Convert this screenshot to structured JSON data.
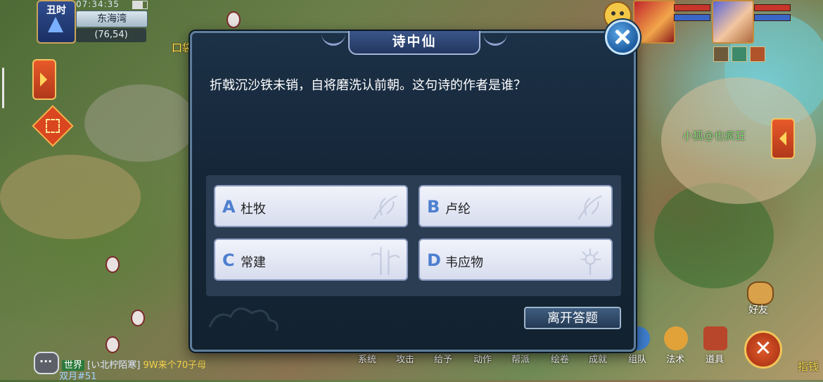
{
  "hud": {
    "time_badge": "丑时",
    "clock": "07:34:35",
    "map_name": "东海湾",
    "coords": "(76,54)",
    "bag_label": "口袋"
  },
  "scene": {
    "player_name": "小狐@也疯狂",
    "edge_text": "指钱"
  },
  "quiz": {
    "title": "诗中仙",
    "question": "折戟沉沙铁未销，自将磨洗认前朝。这句诗的作者是谁？",
    "answers": [
      {
        "letter": "A",
        "text": "杜牧"
      },
      {
        "letter": "B",
        "text": "卢纶"
      },
      {
        "letter": "C",
        "text": "常建"
      },
      {
        "letter": "D",
        "text": "韦应物"
      }
    ],
    "leave_label": "离开答题"
  },
  "menu": {
    "items": [
      "系统",
      "攻击",
      "给予",
      "动作",
      "帮派",
      "绘卷",
      "成就",
      "组队",
      "法术",
      "道具"
    ],
    "friend_label": "好友"
  },
  "chat": {
    "channel": "世界",
    "sender": "[い北柠陌寒]",
    "message": "9W来个70子母",
    "line2": "双月#51"
  },
  "colors": {
    "dialog_bg": "#152638",
    "answer_letter": "#4e7fd0",
    "close_button": "#1d5c9e",
    "chat_message": "#f4d34a"
  }
}
